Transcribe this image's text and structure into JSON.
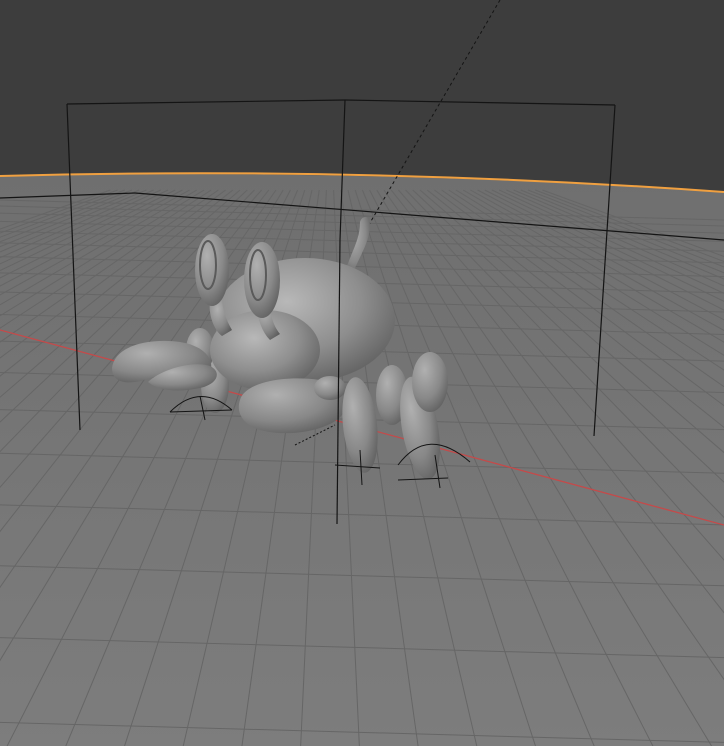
{
  "viewport": {
    "background_color": "#3d3d3d",
    "floor_color": "#7a7a7a",
    "grid_color": "#6e6e6e",
    "horizon_highlight_color": "#f0a040",
    "x_axis_color": "#c44a4a",
    "object_color": "#8c8c8c",
    "object_shadow_color": "#5e5e5e",
    "object_highlight_color": "#b4b4b4",
    "wire_color": "#141414"
  },
  "objects": [
    {
      "name": "crab",
      "icon": "crab-model"
    },
    {
      "name": "cage",
      "icon": "cube-wireframe"
    },
    {
      "name": "light",
      "icon": "light-dashed-line"
    }
  ]
}
